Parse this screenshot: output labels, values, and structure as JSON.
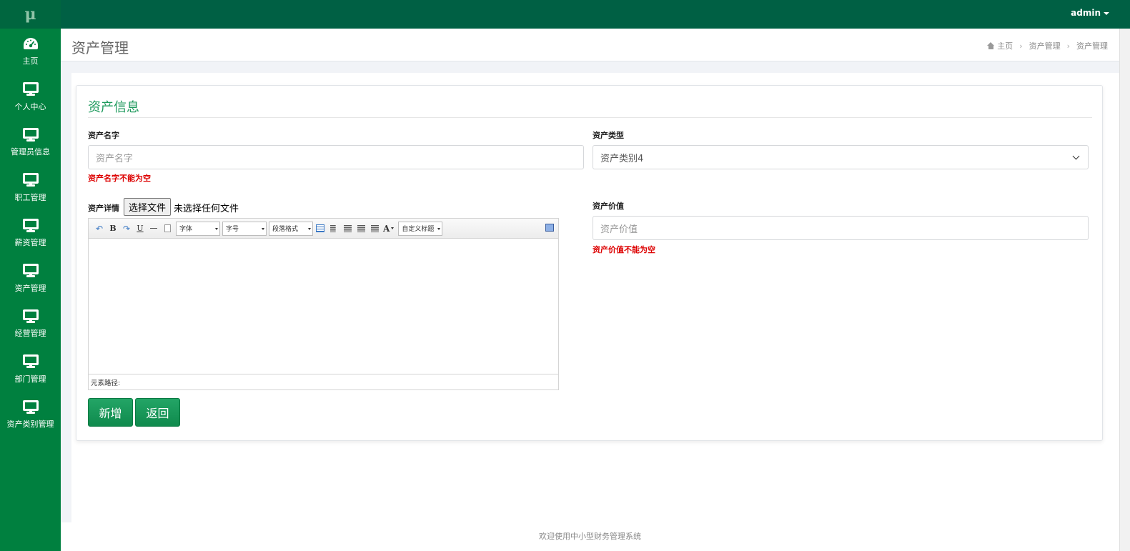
{
  "app": {
    "logo": "μ",
    "user": "admin"
  },
  "sidebar": {
    "items": [
      {
        "label": "主页",
        "icon": "dashboard-icon"
      },
      {
        "label": "个人中心",
        "icon": "monitor-icon"
      },
      {
        "label": "管理员信息",
        "icon": "monitor-icon"
      },
      {
        "label": "职工管理",
        "icon": "monitor-icon"
      },
      {
        "label": "薪资管理",
        "icon": "monitor-icon"
      },
      {
        "label": "资产管理",
        "icon": "monitor-icon"
      },
      {
        "label": "经营管理",
        "icon": "monitor-icon"
      },
      {
        "label": "部门管理",
        "icon": "monitor-icon"
      },
      {
        "label": "资产类别管理",
        "icon": "monitor-icon"
      }
    ]
  },
  "page": {
    "title": "资产管理",
    "breadcrumb": [
      "主页",
      "资产管理",
      "资产管理"
    ]
  },
  "form": {
    "section_title": "资产信息",
    "name": {
      "label": "资产名字",
      "placeholder": "资产名字",
      "error": "资产名字不能为空"
    },
    "type": {
      "label": "资产类型",
      "value": "资产类别4"
    },
    "detail": {
      "label": "资产详情",
      "file_button": "选择文件",
      "file_status": "未选择任何文件"
    },
    "value": {
      "label": "资产价值",
      "placeholder": "资产价值",
      "error": "资产价值不能为空"
    },
    "editor": {
      "font": "字体",
      "size": "字号",
      "paragraph": "段落格式",
      "custom_title": "自定义标题",
      "status": "元素路径:"
    },
    "buttons": {
      "add": "新增",
      "back": "返回"
    }
  },
  "footer": {
    "text": "欢迎使用中小型财务管理系统"
  },
  "colors": {
    "sidebar": "#00803f",
    "topbar": "#006044",
    "accent": "#1f9a5d",
    "error": "#dd0000"
  }
}
